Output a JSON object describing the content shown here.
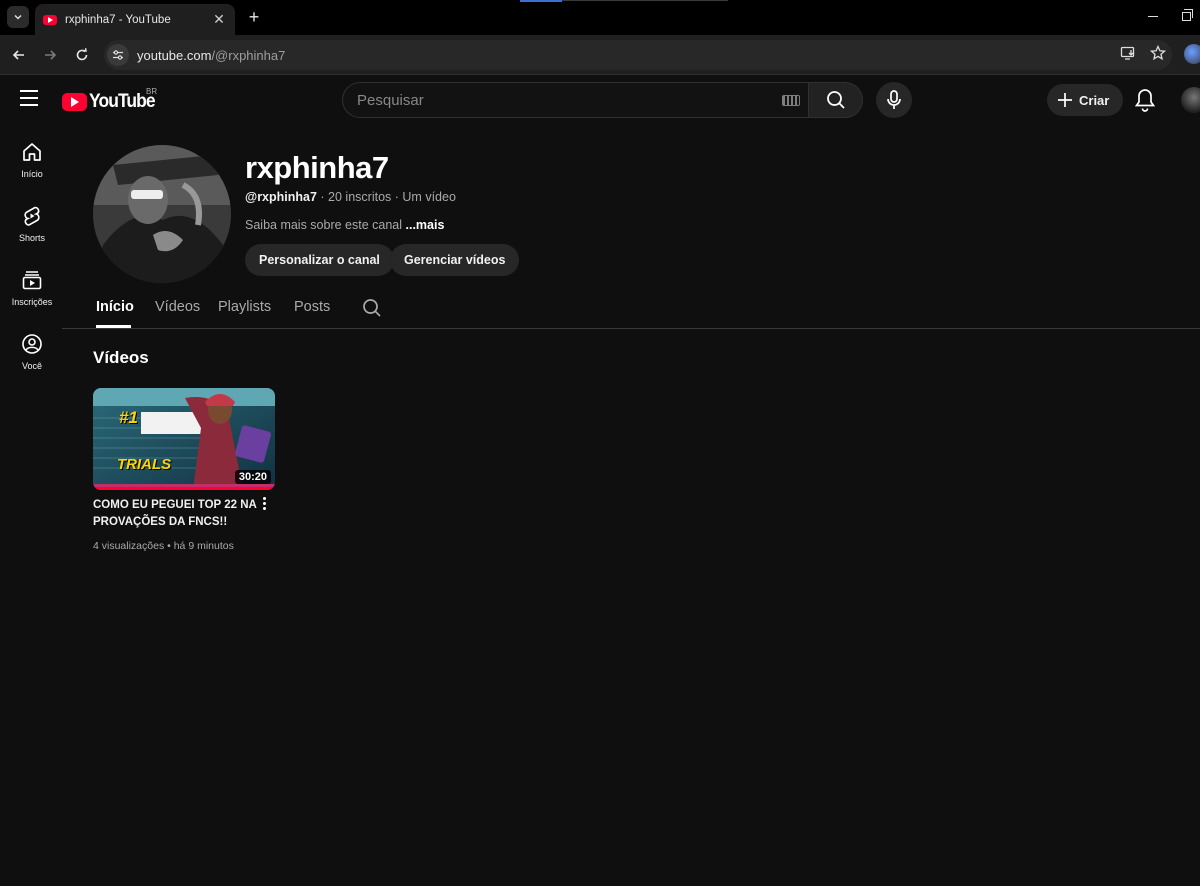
{
  "browser": {
    "tab_title": "rxphinha7 - YouTube",
    "tab_close": "✕",
    "new_tab": "+",
    "url_host": "youtube.com",
    "url_path": "/@rxphinha7"
  },
  "header": {
    "logo_text": "YouTube",
    "region": "BR",
    "search_placeholder": "Pesquisar",
    "create_label": "Criar"
  },
  "sidebar": {
    "items": [
      {
        "label": "Início"
      },
      {
        "label": "Shorts"
      },
      {
        "label": "Inscrições"
      },
      {
        "label": "Você"
      }
    ]
  },
  "channel": {
    "name": "rxphinha7",
    "handle": "@rxphinha7",
    "subscribers": "· 20 inscritos",
    "videos_count": "· Um vídeo",
    "about": "Saiba mais sobre este canal",
    "about_more": "...mais",
    "customize_button": "Personalizar o canal",
    "manage_button": "Gerenciar vídeos"
  },
  "tabs": [
    {
      "label": "Início",
      "active": true
    },
    {
      "label": "Vídeos",
      "active": false
    },
    {
      "label": "Playlists",
      "active": false
    },
    {
      "label": "Posts",
      "active": false
    }
  ],
  "section": {
    "title": "Vídeos"
  },
  "videos": [
    {
      "title": "COMO EU PEGUEI TOP 22 NA PROVAÇÕES DA FNCS!!",
      "duration": "30:20",
      "views": "4 visualizações",
      "age": "há 9 minutos",
      "watched_fraction": 1.0,
      "thumb_text_rank": "#1",
      "thumb_text_trials": "TRIALS"
    }
  ],
  "colors": {
    "background": "#0f0f0f",
    "brand_red": "#ff0033",
    "chip_bg": "#272727",
    "secondary_text": "#aaaaaa"
  }
}
